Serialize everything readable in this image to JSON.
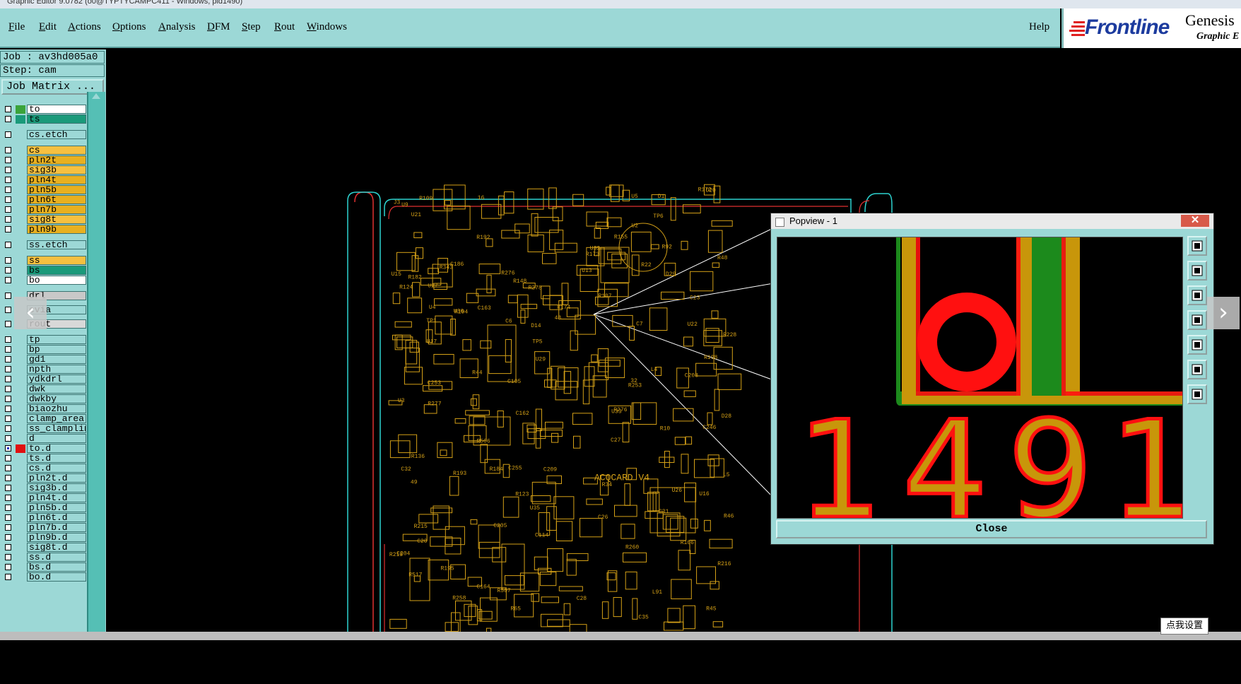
{
  "window": {
    "title": "Graphic Editor 9.0782 (o0@TYPTYCAMPC411 - Windows, pid1490)"
  },
  "menu": {
    "items": [
      "File",
      "Edit",
      "Actions",
      "Options",
      "Analysis",
      "DFM",
      "Step",
      "Rout",
      "Windows"
    ],
    "help": "Help"
  },
  "brand": {
    "logo": "Frontline",
    "product": "Genesis",
    "subtitle": "Graphic E"
  },
  "job": {
    "label": "Job : av3hd005a0",
    "step": "Step: cam",
    "matrix_button": "Job Matrix ..."
  },
  "layers": [
    {
      "name": "to",
      "color": "#ffffff",
      "swatch": "#3aa33a",
      "flag": "»",
      "checked": false
    },
    {
      "name": "ts",
      "color": "#1a9a7a",
      "swatch": "#1a9a7a",
      "flag": "",
      "checked": false
    },
    {
      "name": "cs.etch",
      "color": "#9cd8d6",
      "swatch": "",
      "flag": "",
      "checked": false
    },
    {
      "name": "cs",
      "color": "#f6c040",
      "swatch": "",
      "flag": "",
      "checked": false
    },
    {
      "name": "pln2t",
      "color": "#e8b020",
      "swatch": "",
      "flag": "",
      "checked": false
    },
    {
      "name": "sig3b",
      "color": "#f6c040",
      "swatch": "",
      "flag": "",
      "checked": false
    },
    {
      "name": "pln4t",
      "color": "#e8b020",
      "swatch": "",
      "flag": "",
      "checked": false
    },
    {
      "name": "pln5b",
      "color": "#e8b020",
      "swatch": "",
      "flag": "",
      "checked": false
    },
    {
      "name": "pln6t",
      "color": "#e8b020",
      "swatch": "",
      "flag": "",
      "checked": false
    },
    {
      "name": "pln7b",
      "color": "#e8b020",
      "swatch": "",
      "flag": "",
      "checked": false
    },
    {
      "name": "sig8t",
      "color": "#f6c040",
      "swatch": "",
      "flag": "",
      "checked": false
    },
    {
      "name": "pln9b",
      "color": "#e8b020",
      "swatch": "",
      "flag": "",
      "checked": false
    },
    {
      "name": "ss.etch",
      "color": "#9cd8d6",
      "swatch": "",
      "flag": "",
      "checked": false
    },
    {
      "name": "ss",
      "color": "#f6c040",
      "swatch": "",
      "flag": "",
      "checked": false
    },
    {
      "name": "bs",
      "color": "#1a9a7a",
      "swatch": "",
      "flag": "",
      "checked": false
    },
    {
      "name": "bo",
      "color": "#ffffff",
      "swatch": "",
      "flag": "»",
      "checked": false
    },
    {
      "name": "drl",
      "color": "#c8c8c8",
      "swatch": "",
      "flag": "",
      "checked": false
    },
    {
      "name": "cvia",
      "color": "#9cd8d6",
      "swatch": "",
      "flag": "",
      "checked": false
    },
    {
      "name": "rout",
      "color": "#d8d8d8",
      "swatch": "",
      "flag": "",
      "checked": false
    },
    {
      "name": "tp",
      "color": "#9cd8d6",
      "swatch": "",
      "flag": "",
      "checked": false
    },
    {
      "name": "bp",
      "color": "#9cd8d6",
      "swatch": "",
      "flag": "",
      "checked": false
    },
    {
      "name": "gd1",
      "color": "#9cd8d6",
      "swatch": "",
      "flag": "»",
      "checked": false
    },
    {
      "name": "npth",
      "color": "#9cd8d6",
      "swatch": "",
      "flag": "",
      "checked": false
    },
    {
      "name": "ydkdrl",
      "color": "#9cd8d6",
      "swatch": "",
      "flag": "",
      "checked": false
    },
    {
      "name": "dwk",
      "color": "#9cd8d6",
      "swatch": "",
      "flag": "",
      "checked": false
    },
    {
      "name": "dwkby",
      "color": "#9cd8d6",
      "swatch": "",
      "flag": "",
      "checked": false
    },
    {
      "name": "biaozhu",
      "color": "#9cd8d6",
      "swatch": "",
      "flag": "",
      "checked": false
    },
    {
      "name": "clamp_area",
      "color": "#9cd8d6",
      "swatch": "",
      "flag": "",
      "checked": false
    },
    {
      "name": "ss_clampline",
      "color": "#9cd8d6",
      "swatch": "",
      "flag": "",
      "checked": false
    },
    {
      "name": "d",
      "color": "#9cd8d6",
      "swatch": "",
      "flag": "",
      "checked": false
    },
    {
      "name": "to.d",
      "color": "#9cd8d6",
      "swatch": "#e01010",
      "flag": "»▪",
      "checked": true
    },
    {
      "name": "ts.d",
      "color": "#9cd8d6",
      "swatch": "",
      "flag": "",
      "checked": false
    },
    {
      "name": "cs.d",
      "color": "#9cd8d6",
      "swatch": "",
      "flag": "",
      "checked": false
    },
    {
      "name": "pln2t.d",
      "color": "#9cd8d6",
      "swatch": "",
      "flag": "",
      "checked": false
    },
    {
      "name": "sig3b.d",
      "color": "#9cd8d6",
      "swatch": "",
      "flag": "",
      "checked": false
    },
    {
      "name": "pln4t.d",
      "color": "#9cd8d6",
      "swatch": "",
      "flag": "",
      "checked": false
    },
    {
      "name": "pln5b.d",
      "color": "#9cd8d6",
      "swatch": "",
      "flag": "",
      "checked": false
    },
    {
      "name": "pln6t.d",
      "color": "#9cd8d6",
      "swatch": "",
      "flag": "",
      "checked": false
    },
    {
      "name": "pln7b.d",
      "color": "#9cd8d6",
      "swatch": "",
      "flag": "",
      "checked": false
    },
    {
      "name": "pln9b.d",
      "color": "#9cd8d6",
      "swatch": "",
      "flag": "",
      "checked": false
    },
    {
      "name": "sig8t.d",
      "color": "#9cd8d6",
      "swatch": "",
      "flag": "",
      "checked": false
    },
    {
      "name": "ss.d",
      "color": "#9cd8d6",
      "swatch": "",
      "flag": "",
      "checked": false
    },
    {
      "name": "bs.d",
      "color": "#9cd8d6",
      "swatch": "",
      "flag": "",
      "checked": false
    },
    {
      "name": "bo.d",
      "color": "#9cd8d6",
      "swatch": "",
      "flag": "»",
      "checked": false
    }
  ],
  "board": {
    "labels": [
      "D1",
      "L4",
      "R10",
      "C23",
      "C209",
      "L91",
      "C20",
      "C255",
      "R22",
      "U5",
      "C31",
      "C32",
      "U27",
      "U4",
      "L5",
      "C26",
      "C27",
      "C246",
      "C28",
      "C35",
      "R193",
      "R192",
      "R260",
      "TP1",
      "R136",
      "C208",
      "C204",
      "C205",
      "U32",
      "R506",
      "R507",
      "R194",
      "R195",
      "U29",
      "U15",
      "U9",
      "D28",
      "R148",
      "R44",
      "R184",
      "ACQCARD V4",
      "U17",
      "U2",
      "R517",
      "R48",
      "U13",
      "R182",
      "R343",
      "U36",
      "R45",
      "R46",
      "U16",
      "U3",
      "D29",
      "R215",
      "R155",
      "R216",
      "R219",
      "C186",
      "TP6",
      "R124",
      "R172",
      "R173",
      "R174",
      "R258",
      "R253",
      "C7",
      "C6",
      "48",
      "49",
      "32",
      "16",
      "U26",
      "R34",
      "R65",
      "R123",
      "TP5",
      "C253",
      "J3",
      "C114",
      "R106",
      "R109",
      "R228",
      "R108",
      "U20",
      "D14",
      "U33",
      "U22",
      "U21",
      "C162",
      "C163",
      "C164",
      "U35",
      "R278",
      "R276",
      "R277",
      "R276",
      "R107",
      "R92",
      "C105"
    ],
    "accent": "#d4a017",
    "outline": "#2dd3d0",
    "rout_color": "#e03030"
  },
  "popview": {
    "title": "Popview - 1",
    "close_x": "✕",
    "close_button": "Close",
    "zoom_text": "149",
    "tools": [
      "zoom-fit-icon",
      "move-up-icon",
      "move-down-icon",
      "move-left-icon",
      "move-right-icon",
      "zoom-out-icon",
      "zoom-in-icon"
    ],
    "pad_color": "#c8960a",
    "ring_color": "#ff1010",
    "green_edge": "#1c8a1c"
  },
  "overlay": {
    "tooltip": "点我设置",
    "prev": "‹",
    "next": "›"
  }
}
